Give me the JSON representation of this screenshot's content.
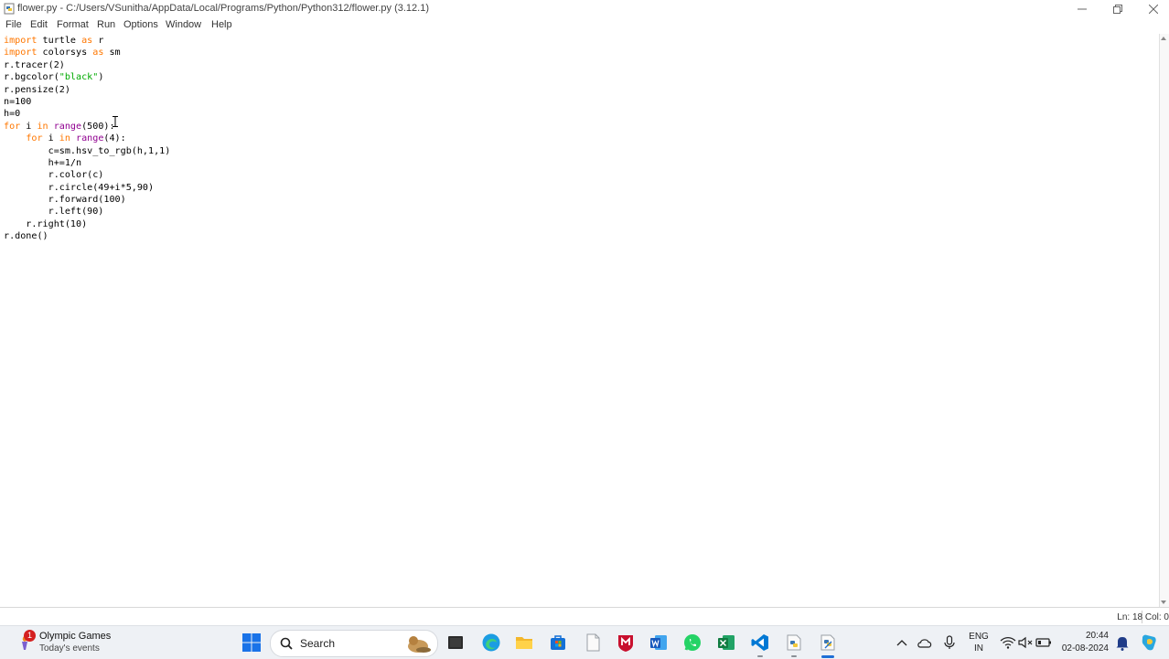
{
  "window": {
    "title": "flower.py - C:/Users/VSunitha/AppData/Local/Programs/Python/Python312/flower.py (3.12.1)"
  },
  "menu": [
    "File",
    "Edit",
    "Format",
    "Run",
    "Options",
    "Window",
    "Help"
  ],
  "code_lines": [
    [
      {
        "t": "import",
        "c": "kw"
      },
      {
        "t": " turtle "
      },
      {
        "t": "as",
        "c": "kw"
      },
      {
        "t": " r"
      }
    ],
    [
      {
        "t": "import",
        "c": "kw"
      },
      {
        "t": " colorsys "
      },
      {
        "t": "as",
        "c": "kw"
      },
      {
        "t": " sm"
      }
    ],
    [
      {
        "t": "r.tracer(2)"
      }
    ],
    [
      {
        "t": "r.bgcolor("
      },
      {
        "t": "\"black\"",
        "c": "str"
      },
      {
        "t": ")"
      }
    ],
    [
      {
        "t": "r.pensize(2)"
      }
    ],
    [
      {
        "t": "n=100"
      }
    ],
    [
      {
        "t": "h=0"
      }
    ],
    [
      {
        "t": "for",
        "c": "kw"
      },
      {
        "t": " i "
      },
      {
        "t": "in",
        "c": "kw"
      },
      {
        "t": " "
      },
      {
        "t": "range",
        "c": "bi"
      },
      {
        "t": "(500):"
      }
    ],
    [
      {
        "t": "    "
      },
      {
        "t": "for",
        "c": "kw"
      },
      {
        "t": " i "
      },
      {
        "t": "in",
        "c": "kw"
      },
      {
        "t": " "
      },
      {
        "t": "range",
        "c": "bi"
      },
      {
        "t": "(4):"
      }
    ],
    [
      {
        "t": "        c=sm.hsv_to_rgb(h,1,1)"
      }
    ],
    [
      {
        "t": "        h+=1/n"
      }
    ],
    [
      {
        "t": "        r.color(c)"
      }
    ],
    [
      {
        "t": "        r.circle(49+i*5,90)"
      }
    ],
    [
      {
        "t": "        r.forward(100)"
      }
    ],
    [
      {
        "t": "        r.left(90)"
      }
    ],
    [
      {
        "t": "    r.right(10)"
      }
    ],
    [
      {
        "t": "r.done()"
      }
    ]
  ],
  "status": {
    "position": "Ln: 18   Col: 0"
  },
  "taskbar": {
    "widget": {
      "badge": "1",
      "title": "Olympic Games",
      "subtitle": "Today's events"
    },
    "search_label": "Search",
    "language": {
      "line1": "ENG",
      "line2": "IN"
    },
    "clock": {
      "time": "20:44",
      "date": "02-08-2024"
    }
  },
  "colors": {
    "keyword": "#ff7700",
    "builtin": "#900090",
    "string": "#00aa00",
    "taskbar_bg": "#eef1f5",
    "accent": "#1f6fd6"
  }
}
